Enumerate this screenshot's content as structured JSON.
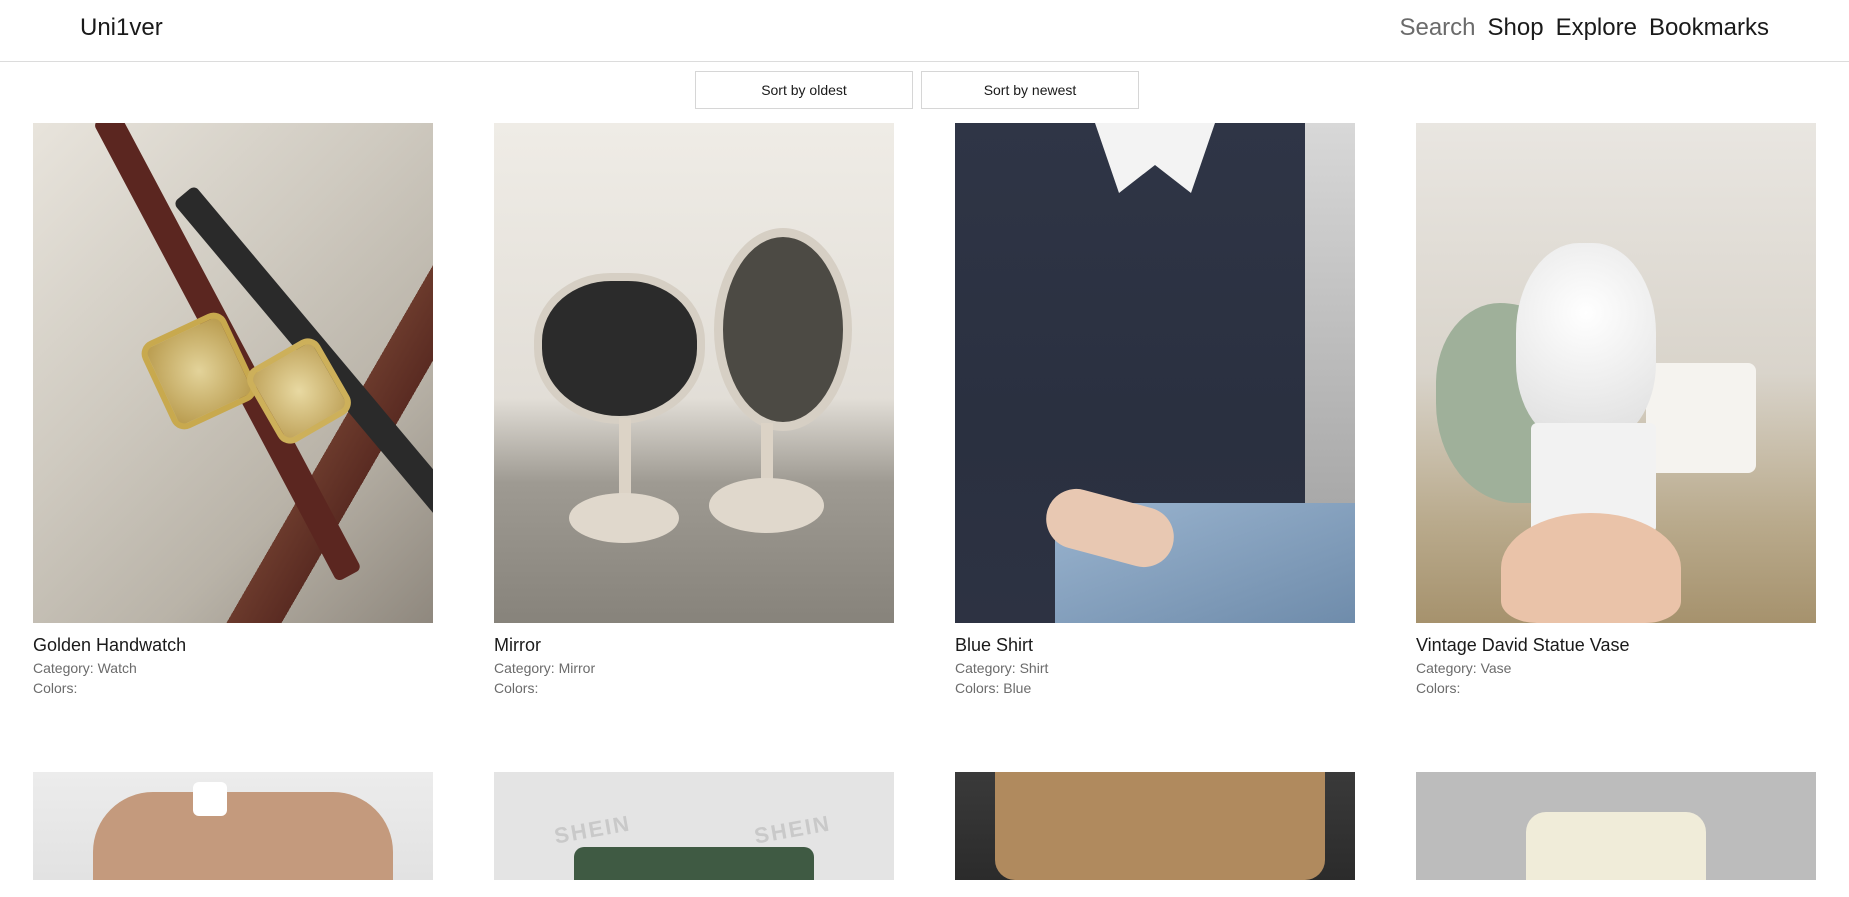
{
  "header": {
    "logo": "Uni1ver",
    "nav": [
      {
        "label": "Search"
      },
      {
        "label": "Shop"
      },
      {
        "label": "Explore"
      },
      {
        "label": "Bookmarks"
      }
    ]
  },
  "sort": {
    "oldest_label": "Sort by oldest",
    "newest_label": "Sort by newest"
  },
  "products": [
    {
      "title": "Golden Handwatch",
      "category": "Category: Watch",
      "colors": "Colors:"
    },
    {
      "title": "Mirror",
      "category": "Category: Mirror",
      "colors": "Colors:"
    },
    {
      "title": "Blue Shirt",
      "category": "Category: Shirt",
      "colors": "Colors: Blue"
    },
    {
      "title": "Vintage David Statue Vase",
      "category": "Category: Vase",
      "colors": "Colors:"
    }
  ],
  "second_row_images": {
    "shein_label_1": "SHEIN",
    "shein_label_2": "SHEIN"
  }
}
